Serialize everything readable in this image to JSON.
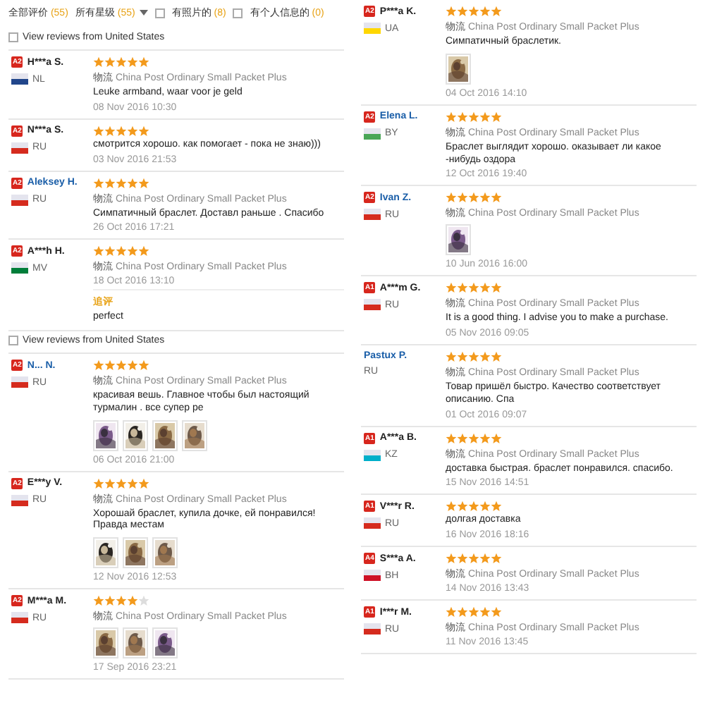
{
  "left": {
    "filters": [
      {
        "kind": "plain",
        "label": "全部评价",
        "count": "(55)"
      },
      {
        "kind": "dropdown",
        "label": "所有星级",
        "count": "(55)"
      },
      {
        "kind": "checkbox",
        "label": "有照片的",
        "count": "(8)",
        "checked": false
      },
      {
        "kind": "checkbox",
        "label": "有个人信息的",
        "count": "(0)",
        "checked": false
      }
    ],
    "items": [
      {
        "kind": "toggle",
        "label": "View reviews from United States",
        "checked": false
      },
      {
        "kind": "review",
        "badge": "A2",
        "name": "H***a S.",
        "is_link": false,
        "color": "#21468b",
        "country": "NL",
        "stars": 5,
        "shipping_label": "物流",
        "shipping": "China Post Ordinary Small Packet Plus",
        "text": "Leuke armband, waar voor je geld",
        "date": "08 Nov 2016 10:30"
      },
      {
        "kind": "review",
        "badge": "A2",
        "name": "N***a S.",
        "is_link": false,
        "color": "#d52b1e",
        "country": "RU",
        "stars": 5,
        "text": "смотрится хорошо. как помогает - пока не знаю)))",
        "date": "03 Nov 2016 21:53"
      },
      {
        "kind": "review",
        "badge": "A2",
        "name": "Aleksey H.",
        "is_link": true,
        "color": "#d52b1e",
        "country": "RU",
        "stars": 5,
        "shipping_label": "物流",
        "shipping": "China Post Ordinary Small Packet Plus",
        "text": "Симпатичный браслет. Доставл раньше . Спасибо",
        "date": "26 Oct 2016 17:21"
      },
      {
        "kind": "review",
        "badge": "A2",
        "name": "A***h H.",
        "is_link": false,
        "color": "#007e3a",
        "country": "MV",
        "stars": 5,
        "shipping_label": "物流",
        "shipping": "China Post Ordinary Small Packet Plus",
        "date": "18 Oct 2016 13:10",
        "followup_label": "追评",
        "followup_text": "perfect"
      },
      {
        "kind": "toggle",
        "label": "View reviews from United States",
        "checked": false
      },
      {
        "kind": "review",
        "badge": "A2",
        "name": "N... N.",
        "is_link": true,
        "color": "#d52b1e",
        "country": "RU",
        "stars": 5,
        "shipping_label": "物流",
        "shipping": "China Post Ordinary Small Packet Plus",
        "text": "красивая вешь. Главное чтобы был настоящий турмалин . все супер ре",
        "photos": [
          {
            "kind": "picture"
          },
          {
            "kind": "picture"
          },
          {
            "kind": "picture"
          },
          {
            "kind": "picture"
          }
        ],
        "date": "06 Oct 2016 21:00"
      },
      {
        "kind": "review",
        "badge": "A2",
        "name": "E***y V.",
        "is_link": false,
        "color": "#d52b1e",
        "country": "RU",
        "stars": 5,
        "shipping_label": "物流",
        "shipping": "China Post Ordinary Small Packet Plus",
        "text": "Хорошай браслет, купила дочке, ей понравился! Правда местам",
        "photos": [
          {
            "kind": "picture"
          },
          {
            "kind": "picture"
          },
          {
            "kind": "picture"
          }
        ],
        "date": "12 Nov 2016 12:53"
      },
      {
        "kind": "review",
        "badge": "A2",
        "name": "M***a M.",
        "is_link": false,
        "color": "#d52b1e",
        "country": "RU",
        "stars": 4,
        "shipping_label": "物流",
        "shipping": "China Post Ordinary Small Packet Plus",
        "photos": [
          {
            "kind": "picture"
          },
          {
            "kind": "picture"
          },
          {
            "kind": "picture"
          }
        ],
        "date": "17 Sep 2016 23:21"
      }
    ]
  },
  "right": {
    "items": [
      {
        "kind": "review",
        "badge": "A2",
        "name": "P***a K.",
        "is_link": false,
        "color": "#ffd700",
        "country": "UA",
        "stars": 5,
        "shipping_label": "物流",
        "shipping": "China Post Ordinary Small Packet Plus",
        "text": "Симпатичный браслетик.",
        "photos": [
          {
            "kind": "picture"
          }
        ],
        "date": "04 Oct 2016 14:10"
      },
      {
        "kind": "review",
        "badge": "A2",
        "name": "Elena L.",
        "is_link": true,
        "color": "#4aa657",
        "country": "BY",
        "stars": 5,
        "shipping_label": "物流",
        "shipping": "China Post Ordinary Small Packet Plus",
        "text": "Браслет выглядит хорошо. оказывает ли какое -нибудь оздора",
        "date": "12 Oct 2016 19:40"
      },
      {
        "kind": "review",
        "badge": "A2",
        "name": "Ivan Z.",
        "is_link": true,
        "color": "#d52b1e",
        "country": "RU",
        "stars": 5,
        "shipping_label": "物流",
        "shipping": "China Post Ordinary Small Packet Plus",
        "photos": [
          {
            "kind": "picture"
          }
        ],
        "date": "10 Jun 2016 16:00"
      },
      {
        "kind": "review",
        "badge": "A1",
        "name": "A***m G.",
        "is_link": false,
        "color": "#d52b1e",
        "country": "RU",
        "stars": 5,
        "shipping_label": "物流",
        "shipping": "China Post Ordinary Small Packet Plus",
        "text": "It is a good thing. I advise you to make a purchase.",
        "date": "05 Nov 2016 09:05"
      },
      {
        "kind": "review",
        "name": "Pastux P.",
        "is_link": true,
        "country": "RU",
        "stars": 5,
        "shipping_label": "物流",
        "shipping": "China Post Ordinary Small Packet Plus",
        "text": "Товар пришёл быстро. Качество соответствует описанию. Спа",
        "date": "01 Oct 2016 09:07"
      },
      {
        "kind": "review",
        "badge": "A1",
        "name": "A***a B.",
        "is_link": false,
        "color": "#00afca",
        "country": "KZ",
        "stars": 5,
        "shipping_label": "物流",
        "shipping": "China Post Ordinary Small Packet Plus",
        "text": "доставка быстрая. браслет понравился. спасибо.",
        "date": "15 Nov 2016 14:51"
      },
      {
        "kind": "review",
        "badge": "A1",
        "name": "V***r R.",
        "is_link": false,
        "color": "#d52b1e",
        "country": "RU",
        "stars": 5,
        "text": "долгая доставка",
        "date": "16 Nov 2016 18:16"
      },
      {
        "kind": "review",
        "badge": "A4",
        "name": "S***a A.",
        "is_link": false,
        "color": "#ce1126",
        "country": "BH",
        "stars": 5,
        "shipping_label": "物流",
        "shipping": "China Post Ordinary Small Packet Plus",
        "date": "14 Nov 2016 13:43"
      },
      {
        "kind": "review",
        "badge": "A1",
        "name": "I***r M.",
        "is_link": false,
        "color": "#d52b1e",
        "country": "RU",
        "stars": 5,
        "shipping_label": "物流",
        "shipping": "China Post Ordinary Small Packet Plus",
        "date": "11 Nov 2016 13:45"
      }
    ]
  }
}
